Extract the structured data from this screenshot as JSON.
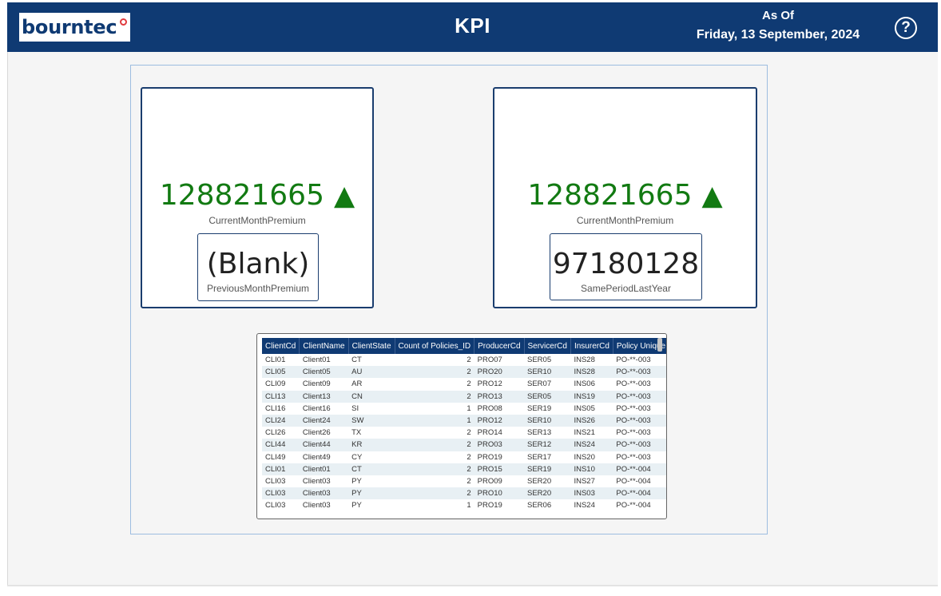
{
  "header": {
    "logo_text": "bourntec",
    "title": "KPI",
    "as_of_label": "As Of",
    "as_of_date": "Friday, 13 September, 2024",
    "help_glyph": "?",
    "brand_color": "#0f3a73"
  },
  "kpi_cards": [
    {
      "value": "128821665",
      "trend_icon": "up-triangle-icon",
      "trend_glyph": "▲",
      "label": "CurrentMonthPremium",
      "comparison": {
        "value": "(Blank)",
        "label": "PreviousMonthPremium"
      }
    },
    {
      "value": "128821665",
      "trend_icon": "up-triangle-icon",
      "trend_glyph": "▲",
      "label": "CurrentMonthPremium",
      "comparison": {
        "value": "97180128",
        "label": "SamePeriodLastYear"
      }
    }
  ],
  "table": {
    "columns": [
      "ClientCd",
      "ClientName",
      "ClientState",
      "Count of Policies_ID",
      "ProducerCd",
      "ServicerCd",
      "InsurerCd",
      "Policy Unique Id"
    ],
    "rows": [
      [
        "CLI01",
        "Client01",
        "CT",
        "2",
        "PRO07",
        "SER05",
        "INS28",
        "PO-**-003"
      ],
      [
        "CLI05",
        "Client05",
        "AU",
        "2",
        "PRO20",
        "SER10",
        "INS28",
        "PO-**-003"
      ],
      [
        "CLI09",
        "Client09",
        "AR",
        "2",
        "PRO12",
        "SER07",
        "INS06",
        "PO-**-003"
      ],
      [
        "CLI13",
        "Client13",
        "CN",
        "2",
        "PRO13",
        "SER05",
        "INS19",
        "PO-**-003"
      ],
      [
        "CLI16",
        "Client16",
        "SI",
        "1",
        "PRO08",
        "SER19",
        "INS05",
        "PO-**-003"
      ],
      [
        "CLI24",
        "Client24",
        "SW",
        "1",
        "PRO12",
        "SER10",
        "INS26",
        "PO-**-003"
      ],
      [
        "CLI26",
        "Client26",
        "TX",
        "2",
        "PRO14",
        "SER13",
        "INS21",
        "PO-**-003"
      ],
      [
        "CLI44",
        "Client44",
        "KR",
        "2",
        "PRO03",
        "SER12",
        "INS24",
        "PO-**-003"
      ],
      [
        "CLI49",
        "Client49",
        "CY",
        "2",
        "PRO19",
        "SER17",
        "INS20",
        "PO-**-003"
      ],
      [
        "CLI01",
        "Client01",
        "CT",
        "2",
        "PRO15",
        "SER19",
        "INS10",
        "PO-**-004"
      ],
      [
        "CLI03",
        "Client03",
        "PY",
        "2",
        "PRO09",
        "SER20",
        "INS27",
        "PO-**-004"
      ],
      [
        "CLI03",
        "Client03",
        "PY",
        "2",
        "PRO10",
        "SER20",
        "INS03",
        "PO-**-004"
      ],
      [
        "CLI03",
        "Client03",
        "PY",
        "1",
        "PRO19",
        "SER06",
        "INS24",
        "PO-**-004"
      ]
    ]
  },
  "colors": {
    "trend_up": "#127a12",
    "table_header": "#0f3a73",
    "row_alt": "#e8f0f4",
    "logo_dot": "#e03a3e"
  }
}
